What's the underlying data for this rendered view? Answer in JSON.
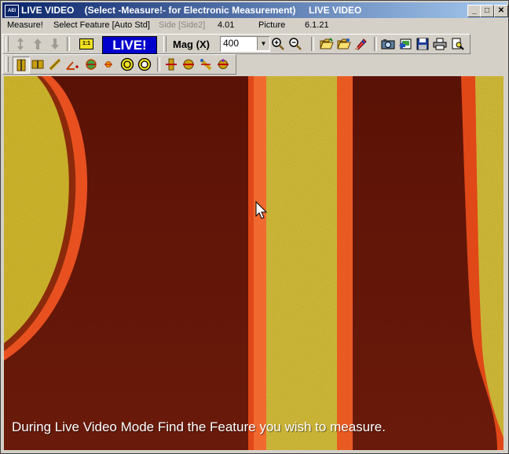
{
  "window": {
    "app_icon_text": "AEI",
    "title": "LIVE VIDEO    (Select -Measure!- for Electronic Measurement)",
    "title_right": "LIVE VIDEO",
    "controls": {
      "minimize": "_",
      "maximize": "□",
      "close": "✕"
    }
  },
  "menu": {
    "items": [
      {
        "label": "Measure!",
        "enabled": true
      },
      {
        "label": "Select Feature [Auto Std]",
        "enabled": true
      },
      {
        "label": "Side [Side2]",
        "enabled": false
      },
      {
        "label": "4.01",
        "enabled": true
      },
      {
        "label": "Picture",
        "enabled": true
      },
      {
        "label": "6.1.21",
        "enabled": true
      }
    ]
  },
  "toolbar": {
    "live_label": "LIVE!",
    "mag_label": "Mag (X)",
    "mag_value": "400",
    "scale_icon_text": "1:1"
  },
  "video": {
    "caption": "During Live Video Mode Find the Feature you wish to measure."
  },
  "colors": {
    "title_start": "#0a246a",
    "title_end": "#a6caf0",
    "live_bg": "#0000cc",
    "substrate": "#5a1008",
    "gold": "#d8c040",
    "copper_edge": "#e04818"
  }
}
